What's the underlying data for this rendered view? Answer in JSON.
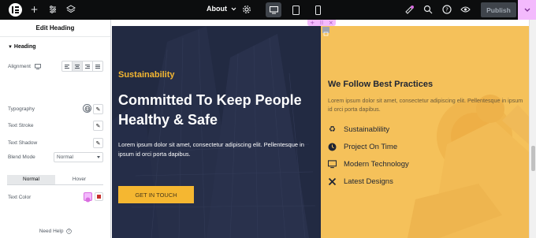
{
  "topbar": {
    "page_name": "About",
    "publish_label": "Publish"
  },
  "panel": {
    "title": "Edit Heading",
    "section": "Heading",
    "labels": {
      "alignment": "Alignment",
      "typography": "Typography",
      "text_stroke": "Text Stroke",
      "text_shadow": "Text Shadow",
      "blend_mode": "Blend Mode",
      "text_color": "Text Color"
    },
    "blend_mode_value": "Normal",
    "tabs": [
      "Normal",
      "Hover"
    ],
    "need_help": "Need Help",
    "colors": {
      "global_swatch": "#d96de0",
      "text_swatch": "#c7302c"
    }
  },
  "hero": {
    "eyebrow": "Sustainability",
    "title": "Committed To Keep People Healthy & Safe",
    "text": "Lorem ipsum dolor sit amet, consectetur adipiscing elit. Pellentesque in ipsum id orci porta dapibus.",
    "cta": "GET IN TOUCH"
  },
  "practices": {
    "title": "We Follow Best Practices",
    "text": "Lorem ipsum dolor sit amet, consectetur adipiscing elit. Pellentesque in ipsum id orci porta dapibus.",
    "features": [
      {
        "icon": "recycle-icon",
        "label": "Sustainablility"
      },
      {
        "icon": "clock-icon",
        "label": "Project On Time"
      },
      {
        "icon": "monitor-icon",
        "label": "Modern Technology"
      },
      {
        "icon": "tools-icon",
        "label": "Latest Designs"
      }
    ]
  },
  "colors": {
    "topbar": "#0c0d0e",
    "accent": "#f5b731",
    "dark_panel": "#242c45",
    "yellow_panel": "#f5c15a",
    "editor_pink": "#f3bafd"
  }
}
